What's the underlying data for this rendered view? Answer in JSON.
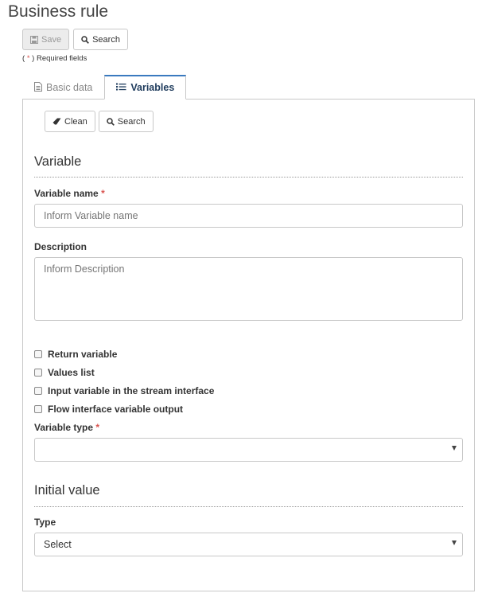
{
  "page": {
    "title": "Business rule"
  },
  "toolbar": {
    "save_label": "Save",
    "search_label": "Search"
  },
  "required_note": {
    "open": "(",
    "star": "*",
    "close": ") Required fields"
  },
  "tabs": [
    {
      "label": "Basic data",
      "icon": "document-icon",
      "active": false
    },
    {
      "label": "Variables",
      "icon": "list-icon",
      "active": true
    }
  ],
  "panel_toolbar": {
    "clean_label": "Clean",
    "search_label": "Search"
  },
  "variable_section": {
    "title": "Variable",
    "name_label": "Variable name",
    "name_placeholder": "Inform Variable name",
    "name_value": "",
    "description_label": "Description",
    "description_placeholder": "Inform Description",
    "description_value": "",
    "checkboxes": [
      {
        "label": "Return variable",
        "checked": false
      },
      {
        "label": "Values list",
        "checked": false
      },
      {
        "label": "Input variable in the stream interface",
        "checked": false
      },
      {
        "label": "Flow interface variable output",
        "checked": false
      }
    ],
    "type_label": "Variable type",
    "type_value": ""
  },
  "initial_value_section": {
    "title": "Initial value",
    "type_label": "Type",
    "type_value": "Select"
  },
  "required_star": "*",
  "colors": {
    "accent": "#3a7abf",
    "required": "#d9534f",
    "tab_active_text": "#1e3b5c"
  }
}
